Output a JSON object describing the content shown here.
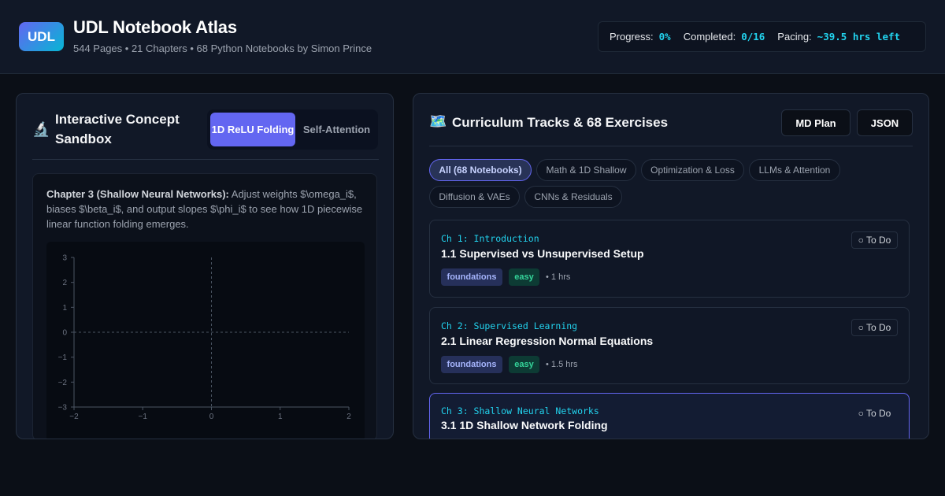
{
  "header": {
    "logo": "UDL",
    "title": "UDL Notebook Atlas",
    "subtitle": "544 Pages • 21 Chapters • 68 Python Notebooks by Simon Prince",
    "stats": {
      "progress_label": "Progress:",
      "progress_value": "0%",
      "completed_label": "Completed:",
      "completed_value": "0/16",
      "pacing_label": "Pacing:",
      "pacing_value": "~39.5 hrs left"
    }
  },
  "sandbox": {
    "title": "Interactive Concept Sandbox",
    "icon": "flask-icon",
    "tabs": [
      {
        "label": "1D ReLU Folding",
        "active": true
      },
      {
        "label": "Self-Attention",
        "active": false
      }
    ],
    "description_bold": "Chapter 3 (Shallow Neural Networks):",
    "description": " Adjust weights $\\omega_i$, biases $\\beta_i$, and output slopes $\\phi_i$ to see how 1D piecewise linear function folding emerges.",
    "plot": {
      "x_ticks": [
        "−2",
        "−1",
        "0",
        "1",
        "2"
      ],
      "y_ticks": [
        "3",
        "2",
        "1",
        "0",
        "−1",
        "−2",
        "−3"
      ]
    }
  },
  "curriculum": {
    "icon": "map-icon",
    "title": "Curriculum Tracks & 68 Exercises",
    "buttons": {
      "md": "MD Plan",
      "json": "JSON"
    },
    "filters": [
      {
        "label": "All (68 Notebooks)",
        "active": true
      },
      {
        "label": "Math & 1D Shallow",
        "active": false
      },
      {
        "label": "Optimization & Loss",
        "active": false
      },
      {
        "label": "LLMs & Attention",
        "active": false
      },
      {
        "label": "Diffusion & VAEs",
        "active": false
      },
      {
        "label": "CNNs & Residuals",
        "active": false
      }
    ],
    "exercises": [
      {
        "chapter": "Ch 1: Introduction",
        "title": "1.1 Supervised vs Unsupervised Setup",
        "status": "○ To Do",
        "topic": "foundations",
        "level": "easy",
        "hours": "• 1 hrs"
      },
      {
        "chapter": "Ch 2: Supervised Learning",
        "title": "2.1 Linear Regression Normal Equations",
        "status": "○ To Do",
        "topic": "foundations",
        "level": "easy",
        "hours": "• 1.5 hrs"
      },
      {
        "chapter": "Ch 3: Shallow Neural Networks",
        "title": "3.1 1D Shallow Network Folding",
        "status": "○ To Do"
      }
    ]
  }
}
